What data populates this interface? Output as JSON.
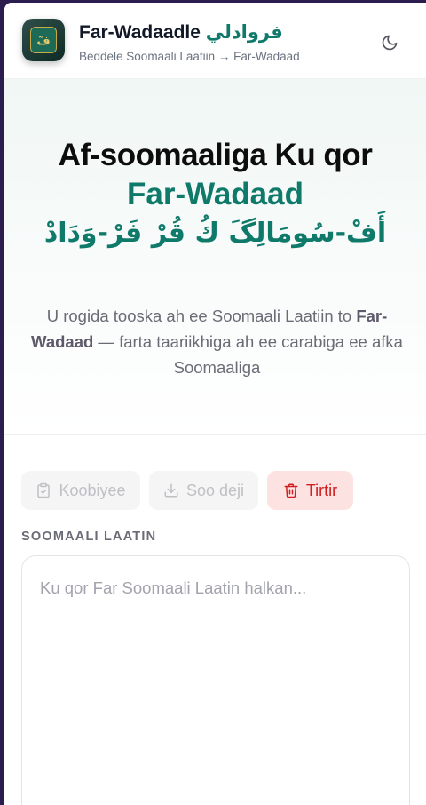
{
  "header": {
    "app_title": "Far-Wadaadle",
    "app_title_arabic": "فروادلي",
    "subtitle": "Beddele Soomaali Laatiin → Far-Wadaad",
    "theme_toggle_icon": "moon-icon",
    "logo_icon": "app-logo-icon",
    "logo_glyph": "فٓ"
  },
  "hero": {
    "heading_line1": "Af-soomaaliga Ku qor",
    "heading_line2": "Far-Wadaad",
    "heading_arabic": "أَفْ-سُومَالِگَ كُ قُرْ فَرْ-وَدَادْ",
    "desc_part1": "U rogida tooska ah ee Soomaali Laatiin to ",
    "desc_bold": "Far-Wadaad",
    "desc_part2": " — farta taariikhiga ah ee carabiga ee afka Soomaaliga"
  },
  "toolbar": {
    "copy_label": "Koobiyee",
    "copy_icon": "clipboard-icon",
    "download_label": "Soo deji",
    "download_icon": "download-icon",
    "clear_label": "Tirtir",
    "clear_icon": "trash-icon"
  },
  "input": {
    "section_label": "SOOMAALI LAATIN",
    "placeholder": "Ku qor Far Soomaali Laatin halkan...",
    "value": ""
  },
  "colors": {
    "accent": "#0f7a6a",
    "danger": "#cf1f1f",
    "danger_bg": "#fde2e2",
    "disabled_text": "#c0c0c5"
  }
}
